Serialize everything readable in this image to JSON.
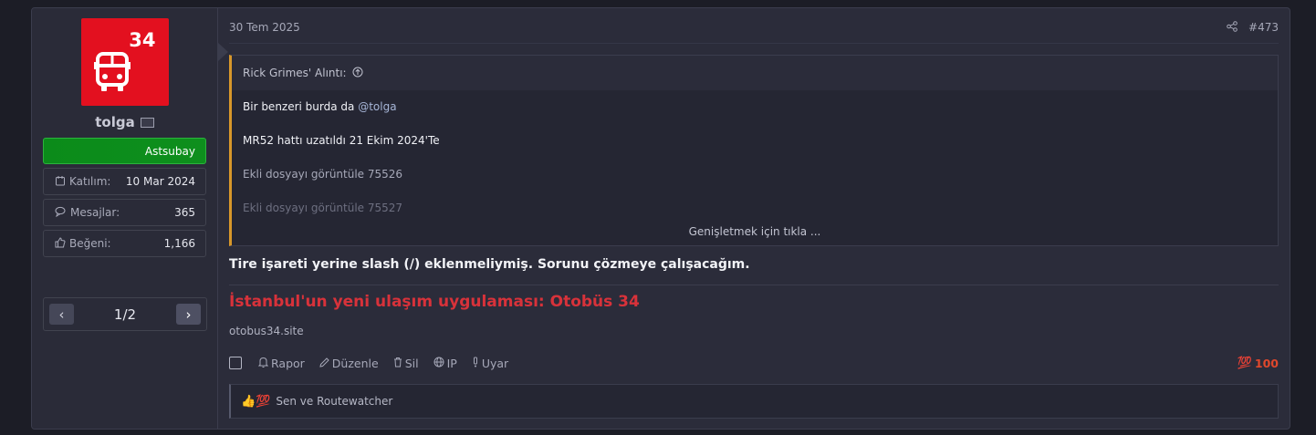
{
  "user": {
    "avatar_number": "34",
    "name": "tolga",
    "rank": "Astsubay",
    "stats": [
      {
        "label": "Katılım:",
        "value": "10 Mar 2024",
        "icon": "calendar-icon"
      },
      {
        "label": "Mesajlar:",
        "value": "365",
        "icon": "messages-icon"
      },
      {
        "label": "Beğeni:",
        "value": "1,166",
        "icon": "thumbs-up-icon"
      }
    ],
    "pager": "1/2"
  },
  "post": {
    "date": "30 Tem 2025",
    "number": "#473",
    "quote": {
      "author": "Rick Grimes' Alıntı:",
      "line1_text": "Bir benzeri burda da ",
      "line1_mention": "@tolga",
      "line2": "MR52 hattı uzatıldı 21 Ekim 2024'Te",
      "line3": "Ekli dosyayı görüntüle 75526",
      "line4": "Ekli dosyayı görüntüle 75527",
      "expand": "Genişletmek için tıkla ..."
    },
    "body": "Tire işareti yerine slash (/) eklenmeliymiş. Sorunu çözmeye çalışacağım.",
    "signature": {
      "title": "İstanbul'un yeni ulaşım uygulaması: Otobüs 34",
      "url": "otobus34.site"
    },
    "actions": {
      "report": "Rapor",
      "edit": "Düzenle",
      "delete": "Sil",
      "ip": "IP",
      "warn": "Uyar",
      "reaction_score": "100"
    },
    "reactions_text": "Sen ve Routewatcher"
  },
  "colors": {
    "accent_red": "#d8323a",
    "rank_green": "#0e8f1d",
    "quote_border": "#d8972a"
  }
}
